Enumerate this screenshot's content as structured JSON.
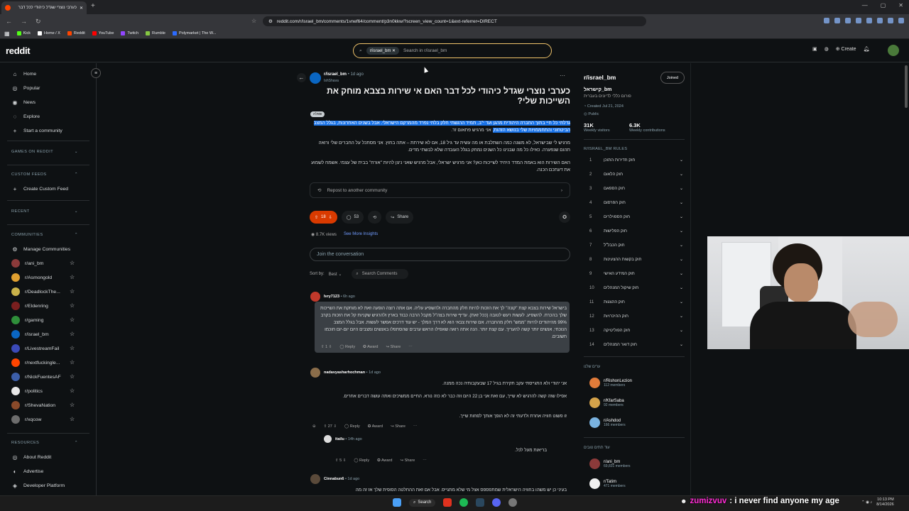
{
  "browser": {
    "tab_title": "כערבי נוצרי שגדל כיהודי לכל דבר",
    "url": "reddit.com/r/israel_bm/comments/1vnef64/comment/p3n0kkw/?screen_view_count=1&ext-referrer=DIRECT",
    "bookmarks": [
      {
        "label": "Kick",
        "color": "#53fc18"
      },
      {
        "label": "Home / X",
        "color": "#ffffff"
      },
      {
        "label": "Reddit",
        "color": "#ff4500"
      },
      {
        "label": "YouTube",
        "color": "#ff0000"
      },
      {
        "label": "Twitch",
        "color": "#9146ff"
      },
      {
        "label": "Rumble",
        "color": "#85c742"
      },
      {
        "label": "Polymarket | The W...",
        "color": "#2c6bff"
      }
    ]
  },
  "header": {
    "logo": "reddit",
    "search_chip": "r/israel_bm",
    "search_placeholder": "Search in r/israel_bm",
    "create_label": "Create"
  },
  "left_nav": {
    "main": [
      {
        "label": "Home",
        "icon": "home-icon",
        "glyph": "⌂"
      },
      {
        "label": "Popular",
        "icon": "popular-icon",
        "glyph": "◎"
      },
      {
        "label": "News",
        "icon": "news-icon",
        "glyph": "◉"
      },
      {
        "label": "Explore",
        "icon": "explore-icon",
        "glyph": "◌"
      },
      {
        "label": "Start a community",
        "icon": "plus-icon",
        "glyph": "+"
      }
    ],
    "games_header": "GAMES ON REDDIT",
    "custom_feeds_header": "CUSTOM FEEDS",
    "create_feed": "Create Custom Feed",
    "recent_header": "RECENT",
    "communities_header": "COMMUNITIES",
    "manage_label": "Manage Communities",
    "communities": [
      {
        "name": "r/ani_bm",
        "color": "#8b3a3a"
      },
      {
        "name": "r/Asmongold",
        "color": "#e0a030"
      },
      {
        "name": "r/DeadlockThe...",
        "color": "#c9b24a"
      },
      {
        "name": "r/Eldenring",
        "color": "#7a1f1f"
      },
      {
        "name": "r/gaming",
        "color": "#2f8f3a"
      },
      {
        "name": "r/israel_bm",
        "color": "#0a66c2"
      },
      {
        "name": "r/LivestreamFail",
        "color": "#3b4ab8"
      },
      {
        "name": "r/nextfuckingle...",
        "color": "#ff4500"
      },
      {
        "name": "r/NickFuentesAF",
        "color": "#3c5ea8"
      },
      {
        "name": "r/politics",
        "color": "#e8e8e8"
      },
      {
        "name": "r/ShevaNation",
        "color": "#8a4a2a"
      },
      {
        "name": "r/xqcow",
        "color": "#6d6d6d"
      }
    ],
    "resources_header": "RESOURCES",
    "resources": [
      {
        "label": "About Reddit",
        "glyph": "◎"
      },
      {
        "label": "Advertise",
        "glyph": "◐"
      },
      {
        "label": "Developer Platform",
        "glyph": "◈"
      }
    ]
  },
  "post": {
    "subreddit": "r/israel_bm",
    "age": "• 1d ago",
    "author": "IshShava",
    "title": "כערבי נוצרי שגדל כיהודי לכל דבר האם אי שירות בצבא מוחק את השייכות שלי?",
    "flair": "שאלה",
    "body": [
      {
        "hl": "גדלתי כל חיי בתוך החברה היהודית מהגן ועד י\"ב, תמיד הרגשתי חלק בלתי נפרד מהמרקם הישראלי. אבל בשנים האחרונות, בגלל המצב הביטחוני והתחממויות שלי בנושא הזהות,",
        "rest": " אני מרגיש פתאום זר."
      },
      {
        "hl": "",
        "rest": "מרגיש לי שבישראל, לא משנה כמה השתלבת או מה עשית עד גיל 18, אם לא שירתת – אתה בחוץ. אני מסתכל על החברים שלי ורואה תהום שנפערה. כאילו כל מה שבנינו כל השנים נמחק בגלל העובדה שלא לבשתי מדים."
      },
      {
        "hl": "",
        "rest": "האם השירות הוא באמת המדד היחיד לשייכות כאן? אני מרגיש ישראלי, אבל מרגיש שאני ניצן להיות \"אורח\" בבית של עצמי. אשמח לשמוע את דעתכם הכנה."
      }
    ],
    "repost_label": "Repost to another community",
    "votes": "18",
    "comments": "53",
    "share_label": "Share",
    "views": "8.7K views",
    "insights_label": "See More Insights",
    "join_placeholder": "Join the conversation",
    "sort_by": "Sort by:",
    "sort_value": "Best",
    "search_comments": "Search Comments"
  },
  "comments": [
    {
      "user": "Ivry7123",
      "age": "• 6h ago",
      "text": "בישראל שירות בצבא קצת \"קונה\" לך את הזכות להיות חלק מהחברה ולהשפיע עליה. אם אתה רוצה הופעה זאת לא מוחקת את השייכות שלך בהכרח. להשפיע. לעשות רעש לטובה (ככל זאת). עדיף שירות בצה\"ל מקבל הרבה כבוד בארץ ולהרגיש שקניות קל את הזכות בקרב 99% מהיהודים להיות \"ממש\" חלק מהחברה. אם שירות צבאי הוא לא דרך המלך - יש עוד דרכים אפשר לעשות. אבל בגלל המצב הנוכחי, אנשים יותר קשה להעריך. עם קצת יותר. הנה אתה רואה שאפילו הראש ערבים שהסתפלו באנשים ומצבים היום יום-יום חוכמו חשובים.",
      "votes": "1",
      "reply": "Reply",
      "award": "Award",
      "share": "Share"
    },
    {
      "user": "nadavyasharhochman",
      "age": "• 1d ago",
      "lines": [
        "אני יהודי ולא התגייסתי עקב תקירת בגיל 17 שבעקבותיה נכה ממנה.",
        "אפילו שזה קשה להרגיש לא שייך, עם זאת אני בן 22 היום וזה כבר לא כזה נורא. החיים ממשיכים ואתה עושה דברים אחרים.",
        "זו פשוט חוויה אחרת ולדעתי זה לא הופך אותך לפחות שייך."
      ],
      "votes": "27",
      "reply": "Reply",
      "award": "Award",
      "share": "Share"
    },
    {
      "user": "itailu",
      "age": "• 14h ago",
      "text": "בריאות מעל לכל.",
      "votes": "5",
      "reply": "Reply",
      "award": "Award",
      "share": "Share"
    },
    {
      "user": "Cinnabun6",
      "age": "• 1d ago",
      "text": "בעיני כן יש משהו בחוויה הישראלית שמתפספס אצל מי שלא מתגייס. אבל אם זאת ההחלטה הסופית שלך אז זה מה"
    }
  ],
  "sidebar": {
    "name": "r/israel_bm",
    "joined": "Joined",
    "subtitle": "קישראל_bm",
    "desc": "פורום כללי לדיונים בעברית",
    "created": "Created Jul 21, 2024",
    "visibility": "Public",
    "visitors": "31K",
    "visitors_label": "Weekly visitors",
    "contrib": "6.3K",
    "contrib_label": "Weekly contributions",
    "rules_header": "R/ISRAEL_BM RULES",
    "rules": [
      "חוק חדירות התוכן",
      "חוק הלאום",
      "חוק הספאם",
      "חוק הפרסום",
      "חוק הספוילרים",
      "חוק הפלישות",
      "חוק הכבל\"ל",
      "חוק בקשות ההצעינות",
      "חוק המידע האישי",
      "חוק שיקול המנהלים",
      "חוק ההצגות",
      "חוק ההיכרויות",
      "חוק הפוליטיקה",
      "חוק דואר המנהלים"
    ],
    "cities_header": "ערים שלנו",
    "cities": [
      {
        "name": "r/RishonLezion",
        "members": "112 members",
        "color": "#e07b3a"
      },
      {
        "name": "r/KfarSaba",
        "members": "92 members",
        "color": "#d4a24a"
      },
      {
        "name": "r/Ashdod",
        "members": "166 members",
        "color": "#7ab3e0"
      }
    ],
    "more_header": "עוד תתים טובים",
    "more": [
      {
        "name": "r/ani_bm",
        "members": "69,831 members",
        "color": "#8b3a3a"
      },
      {
        "name": "r/Tatim",
        "members": "471 members",
        "color": "#f0f0f0"
      }
    ]
  },
  "stream": {
    "chat_user": "zumizvuv",
    "chat_msg": ": i never find anyone my age"
  },
  "taskbar": {
    "search": "Search",
    "time": "10:13 PM",
    "date": "8/14/2026"
  }
}
